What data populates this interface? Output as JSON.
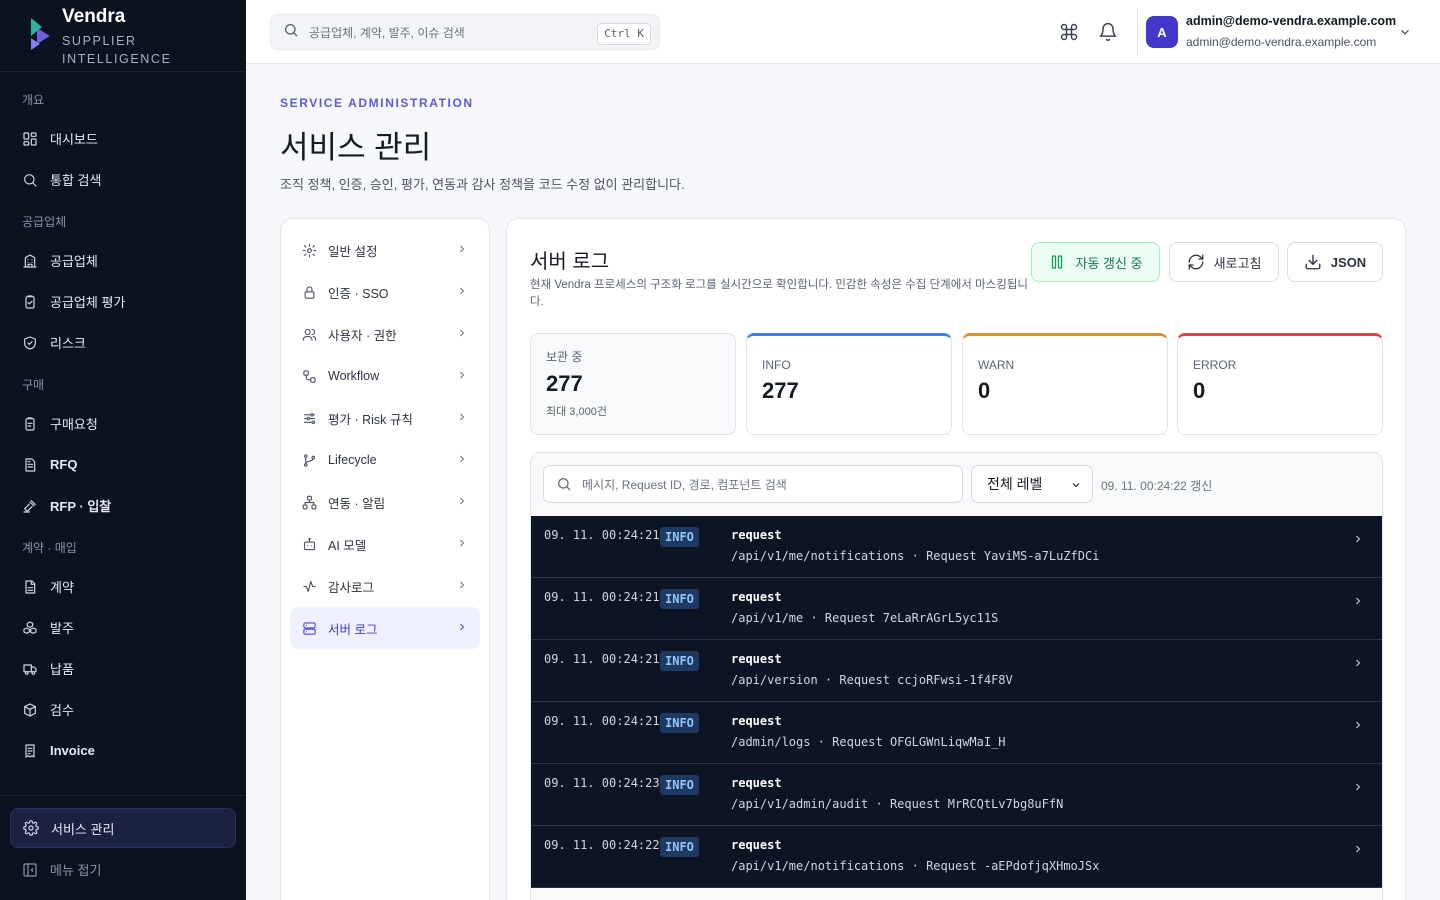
{
  "brand": {
    "name": "Vendra",
    "subtitle_line1": "SUPPLIER",
    "subtitle_line2": "INTELLIGENCE"
  },
  "sidebar": {
    "sections": [
      {
        "title": "개요",
        "items": [
          {
            "label": "대시보드",
            "icon": "dashboard-icon"
          },
          {
            "label": "통합 검색",
            "icon": "search-icon"
          }
        ]
      },
      {
        "title": "공급업체",
        "items": [
          {
            "label": "공급업체",
            "icon": "building-icon"
          },
          {
            "label": "공급업체 평가",
            "icon": "clipboard-check-icon"
          },
          {
            "label": "리스크",
            "icon": "shield-check-icon"
          }
        ]
      },
      {
        "title": "구매",
        "items": [
          {
            "label": "구매요청",
            "icon": "clipboard-icon"
          },
          {
            "label": "RFQ",
            "icon": "document-list-icon"
          },
          {
            "label": "RFP · 입찰",
            "icon": "gavel-icon"
          }
        ]
      },
      {
        "title": "계약 · 매입",
        "items": [
          {
            "label": "계약",
            "icon": "file-text-icon"
          },
          {
            "label": "발주",
            "icon": "boxes-icon"
          },
          {
            "label": "납품",
            "icon": "truck-icon"
          },
          {
            "label": "검수",
            "icon": "package-check-icon"
          },
          {
            "label": "Invoice",
            "icon": "invoice-icon"
          }
        ]
      }
    ],
    "active_item": "서비스 관리",
    "collapse_label": "메뉴 접기"
  },
  "topbar": {
    "search_placeholder": "공급업체, 계약, 발주, 이슈 검색",
    "shortcut": "Ctrl K",
    "user": {
      "initial": "A",
      "name": "admin@demo-vendra.example.com",
      "email": "admin@demo-vendra.example.com"
    }
  },
  "header": {
    "eyebrow": "SERVICE ADMINISTRATION",
    "title": "서비스 관리",
    "description": "조직 정책, 인증, 승인, 평가, 연동과 감사 정책을 코드 수정 없이 관리합니다."
  },
  "settings_nav": [
    {
      "label": "일반 설정",
      "icon": "gear-icon"
    },
    {
      "label": "인증 · SSO",
      "icon": "lock-icon"
    },
    {
      "label": "사용자 · 권한",
      "icon": "users-icon"
    },
    {
      "label": "Workflow",
      "icon": "workflow-icon"
    },
    {
      "label": "평가 · Risk 규칙",
      "icon": "sliders-icon"
    },
    {
      "label": "Lifecycle",
      "icon": "git-branch-icon"
    },
    {
      "label": "연동 · 알림",
      "icon": "network-icon"
    },
    {
      "label": "AI 모델",
      "icon": "bot-icon"
    },
    {
      "label": "감사로그",
      "icon": "activity-icon"
    },
    {
      "label": "서버 로그",
      "icon": "server-icon",
      "active": true
    }
  ],
  "panel": {
    "title": "서버 로그",
    "description": "현재 Vendra 프로세스의 구조화 로그를 실시간으로 확인합니다. 민감한 속성은 수집 단계에서 마스킹됩니다.",
    "buttons": {
      "live": "자동 갱신 중",
      "refresh": "새로고침",
      "export": "JSON"
    },
    "stats": {
      "retained": {
        "label": "보관 중",
        "value": "277",
        "sub": "최대 3,000건"
      },
      "info": {
        "label": "INFO",
        "value": "277"
      },
      "warn": {
        "label": "WARN",
        "value": "0"
      },
      "error": {
        "label": "ERROR",
        "value": "0"
      }
    },
    "filter": {
      "search_placeholder": "메시지, Request ID, 경로, 컴포넌트 검색",
      "level": "전체 레벨",
      "updated": "09. 11. 00:24:22 갱신"
    },
    "logs": [
      {
        "time": "09. 11. 00:24:21",
        "level": "INFO",
        "message": "request",
        "detail": "/api/v1/me/notifications · Request YaviMS-a7LuZfDCi"
      },
      {
        "time": "09. 11. 00:24:21",
        "level": "INFO",
        "message": "request",
        "detail": "/api/v1/me · Request 7eLaRrAGrL5yc11S"
      },
      {
        "time": "09. 11. 00:24:21",
        "level": "INFO",
        "message": "request",
        "detail": "/api/version · Request ccjoRFwsi-1f4F8V"
      },
      {
        "time": "09. 11. 00:24:21",
        "level": "INFO",
        "message": "request",
        "detail": "/admin/logs · Request OFGLGWnLiqwMaI_H"
      },
      {
        "time": "09. 11. 00:24:23",
        "level": "INFO",
        "message": "request",
        "detail": "/api/v1/admin/audit · Request MrRCQtLv7bg8uFfN"
      },
      {
        "time": "09. 11. 00:24:22",
        "level": "INFO",
        "message": "request",
        "detail": "/api/v1/me/notifications · Request -aEPdofjqXHmoJSx"
      }
    ]
  },
  "colors": {
    "accent": "#5b5bd6",
    "sidebar_bg": "#0b1220",
    "info": "#3b82f6",
    "warn": "#e0902b",
    "error": "#e0434b",
    "live": "#157a4b"
  }
}
